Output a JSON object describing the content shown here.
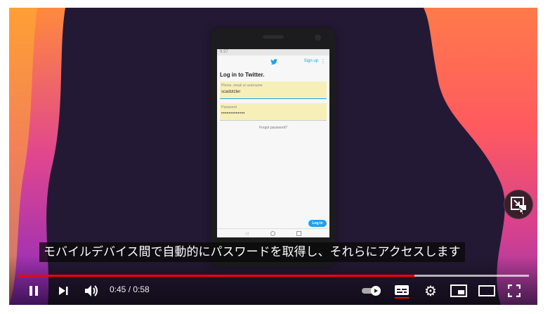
{
  "video": {
    "phone": {
      "status_time": "9:37",
      "signup_label": "Sign up",
      "login_title": "Log in to Twitter.",
      "username_label": "Phone, email or username",
      "username_value": "scadotzler",
      "password_label": "Password",
      "password_value": "•••••••••••••",
      "forgot_label": "Forgot password?",
      "login_button": "Log in"
    },
    "caption": "モバイルデバイス間で自動的にパスワードを取得し、それらにアクセスします"
  },
  "controls": {
    "current_time": "0:45",
    "separator": " / ",
    "duration": "0:58",
    "progress_fraction": 0.776,
    "buffer_fraction": 1.0,
    "autoplay_on": true,
    "subtitles_on": true
  },
  "colors": {
    "progress": "#ff0000",
    "background": "#241934",
    "twitter_blue": "#1da1f2",
    "autofill": "#f7efb8"
  },
  "icons": {
    "play_pause": "pause-icon",
    "next": "next-icon",
    "volume": "volume-icon",
    "autoplay": "autoplay-toggle-icon",
    "subtitles": "subtitles-icon",
    "settings": "gear-icon",
    "miniplayer": "miniplayer-icon",
    "theater": "theater-mode-icon",
    "fullscreen": "fullscreen-icon"
  }
}
